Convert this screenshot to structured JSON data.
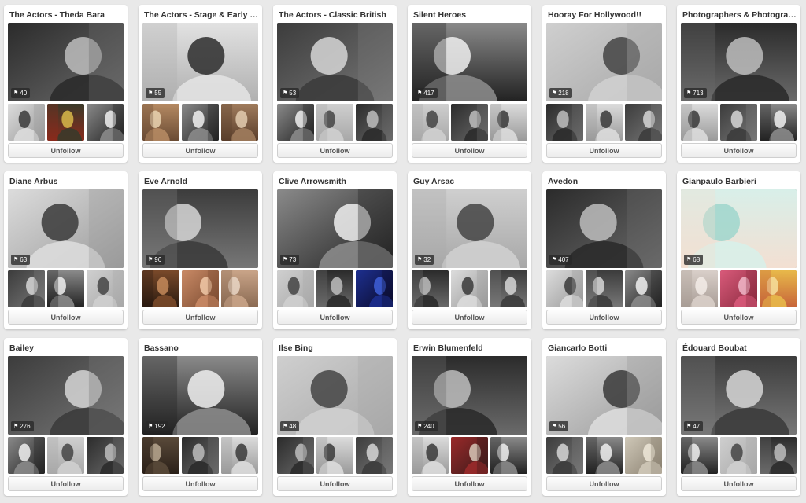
{
  "button_label": "Unfollow",
  "pin_icon": "pin-icon",
  "boards": [
    {
      "name": "The Actors - Theda Bara",
      "pins": "40"
    },
    {
      "name": "The Actors - Stage & Early Si...",
      "pins": "55"
    },
    {
      "name": "The Actors - Classic British",
      "pins": "53"
    },
    {
      "name": "Silent Heroes",
      "pins": "417"
    },
    {
      "name": "Hooray For Hollywood!!",
      "pins": "218"
    },
    {
      "name": "Photographers & Photography",
      "pins": "713"
    },
    {
      "name": "Diane Arbus",
      "pins": "63"
    },
    {
      "name": "Eve Arnold",
      "pins": "96"
    },
    {
      "name": "Clive Arrowsmith",
      "pins": "73"
    },
    {
      "name": "Guy Arsac",
      "pins": "32"
    },
    {
      "name": "Avedon",
      "pins": "407"
    },
    {
      "name": "Gianpaulo Barbieri",
      "pins": "68"
    },
    {
      "name": "Bailey",
      "pins": "276"
    },
    {
      "name": "Bassano",
      "pins": "192"
    },
    {
      "name": "Ilse Bing",
      "pins": "48"
    },
    {
      "name": "Erwin Blumenfeld",
      "pins": "240"
    },
    {
      "name": "Giancarlo Botti",
      "pins": "56"
    },
    {
      "name": "Édouard Boubat",
      "pins": "47"
    }
  ]
}
